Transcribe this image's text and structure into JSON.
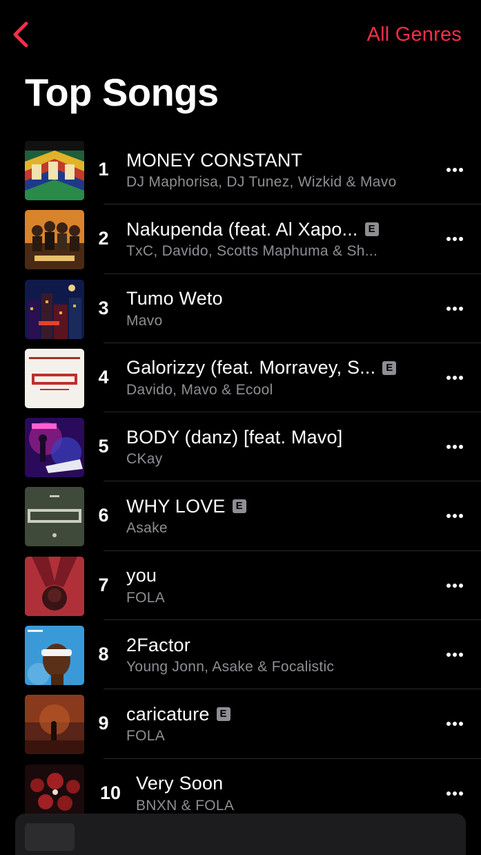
{
  "nav": {
    "back_icon": "chevron-left-icon",
    "genres_label": "All Genres",
    "accent_color": "#fa2d48"
  },
  "page": {
    "title": "Top Songs"
  },
  "explicit_badge": "E",
  "songs": [
    {
      "rank": "1",
      "title": "MONEY CONSTANT",
      "artist": "DJ Maphorisa, DJ Tunez, Wizkid & Mavo",
      "explicit": false
    },
    {
      "rank": "2",
      "title": "Nakupenda (feat. Al Xapo...",
      "artist": "TxC, Davido, Scotts Maphuma & Sh...",
      "explicit": true
    },
    {
      "rank": "3",
      "title": "Tumo Weto",
      "artist": "Mavo",
      "explicit": false
    },
    {
      "rank": "4",
      "title": "Galorizzy (feat. Morravey, S...",
      "artist": "Davido, Mavo & Ecool",
      "explicit": true
    },
    {
      "rank": "5",
      "title": "BODY (danz) [feat. Mavo]",
      "artist": "CKay",
      "explicit": false
    },
    {
      "rank": "6",
      "title": "WHY LOVE",
      "artist": "Asake",
      "explicit": true
    },
    {
      "rank": "7",
      "title": "you",
      "artist": "FOLA",
      "explicit": false
    },
    {
      "rank": "8",
      "title": "2Factor",
      "artist": "Young Jonn, Asake & Focalistic",
      "explicit": false
    },
    {
      "rank": "9",
      "title": "caricature",
      "artist": "FOLA",
      "explicit": true
    },
    {
      "rank": "10",
      "title": "Very Soon",
      "artist": "BNXN & FOLA",
      "explicit": false
    }
  ],
  "more_icon": "ellipsis-icon"
}
